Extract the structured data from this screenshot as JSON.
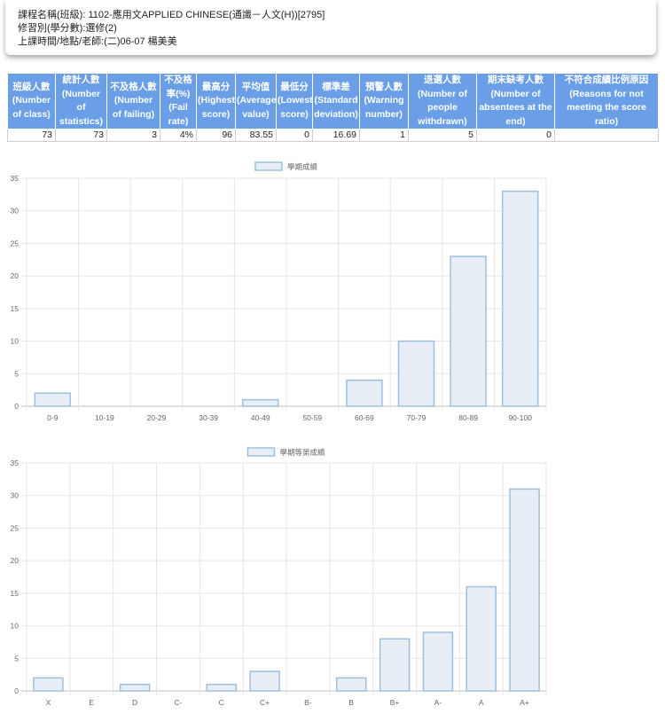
{
  "course_info": {
    "line1": "課程名稱(班級): 1102-應用文APPLIED CHINESE(通識－人文(H))[2795]",
    "line2": "修習別(學分數):選修(2)",
    "line3": "上課時間/地點/老師:(二)06-07 楊美美"
  },
  "stats_table": {
    "headers": [
      "班級人數\n(Number\nof class)",
      "統計人數\n(Number of\nstatistics)",
      "不及格人數\n(Number\nof failing)",
      "不及格\n率(%)\n(Fail\nrate)",
      "最高分\n(Highest\nscore)",
      "平均值\n(Average\nvalue)",
      "最低分\n(Lowest\nscore)",
      "標準差\n(Standard\ndeviation)",
      "預警人數\n(Warning\nnumber)",
      "退選人數\n(Number of\npeople\nwithdrawn)",
      "期末缺考人數\n(Number of\nabsentees at the\nend)",
      "不符合成績比例原因\n(Reasons for not\nmeeting the score\nratio)"
    ],
    "values": [
      "73",
      "73",
      "3",
      "4%",
      "96",
      "83.55",
      "0",
      "16.69",
      "1",
      "5",
      "0",
      ""
    ]
  },
  "colors": {
    "header_bg": "#6a9fe8",
    "bar_fill": "#e7eef5",
    "bar_stroke": "#9dc0dc",
    "grid": "#e6e6e6",
    "axis_text": "#666666"
  },
  "chart_data": [
    {
      "type": "bar",
      "legend": "學期成績",
      "legend_position": "top-center",
      "categories": [
        "0-9",
        "10-19",
        "20-29",
        "30-39",
        "40-49",
        "50-59",
        "60-69",
        "70-79",
        "80-89",
        "90-100"
      ],
      "series": [
        {
          "name": "學期成績",
          "values": [
            2,
            0,
            0,
            0,
            1,
            0,
            4,
            10,
            23,
            33
          ]
        }
      ],
      "ylim": [
        0,
        35
      ],
      "yticks": [
        "0",
        "5",
        "10",
        "15",
        "20",
        "25",
        "30",
        "35"
      ],
      "grid": true
    },
    {
      "type": "bar",
      "legend": "學期等第成績",
      "legend_position": "top-center",
      "categories": [
        "X",
        "E",
        "D",
        "C-",
        "C",
        "C+",
        "B-",
        "B",
        "B+",
        "A-",
        "A",
        "A+"
      ],
      "series": [
        {
          "name": "學期等第成績",
          "values": [
            2,
            0,
            1,
            0,
            1,
            3,
            0,
            2,
            8,
            9,
            16,
            31
          ]
        }
      ],
      "ylim": [
        0,
        35
      ],
      "yticks": [
        "0",
        "5",
        "10",
        "15",
        "20",
        "25",
        "30",
        "35"
      ],
      "grid": true
    }
  ]
}
